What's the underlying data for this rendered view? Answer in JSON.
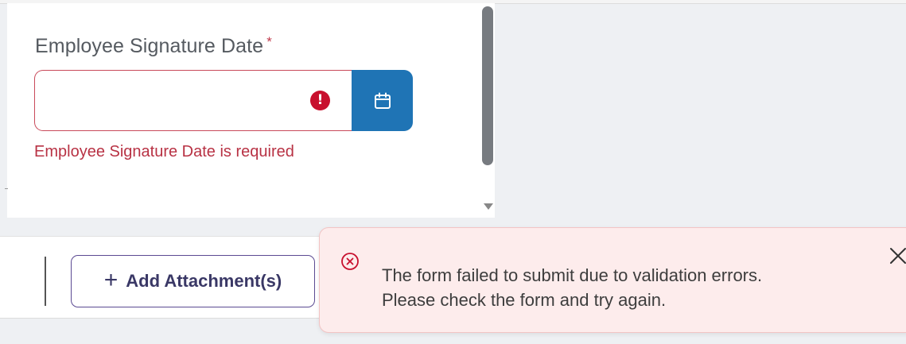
{
  "form": {
    "field_label": "Employee Signature Date",
    "required_marker": "*",
    "date_value": "",
    "error_message": "Employee Signature Date is required"
  },
  "footer": {
    "attach_plus": "+",
    "attach_label": "Add Attachment(s)"
  },
  "toast": {
    "line1": "The form failed to submit due to validation errors.",
    "line2": "Please check the form and try again."
  },
  "colors": {
    "error": "#c8102e",
    "calendar_button": "#1f74b5",
    "attach_border": "#5b4a92",
    "toast_bg": "#fdecec"
  },
  "icons": {
    "error": "exclamation-circle-icon",
    "calendar": "calendar-icon",
    "toast_error": "x-circle-icon",
    "close": "close-icon"
  }
}
